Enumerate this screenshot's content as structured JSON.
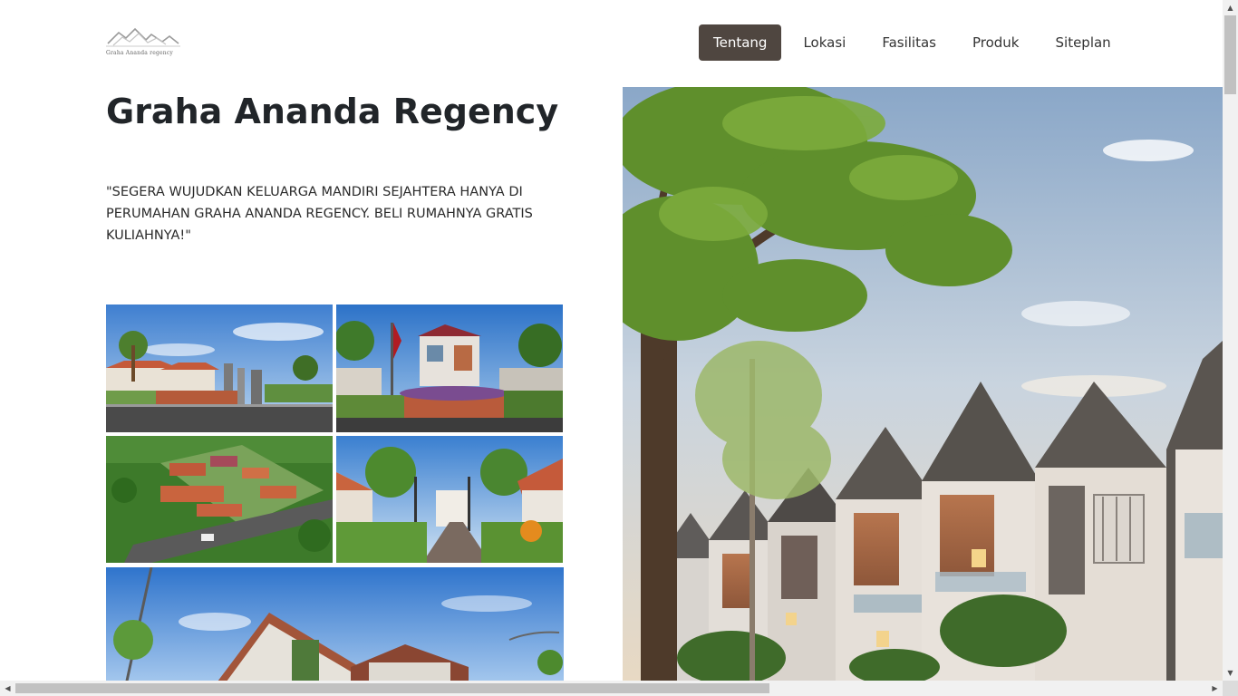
{
  "logo": {
    "text": "Graha Ananda regency"
  },
  "nav": {
    "items": [
      {
        "label": "Tentang",
        "active": true
      },
      {
        "label": "Lokasi",
        "active": false
      },
      {
        "label": "Fasilitas",
        "active": false
      },
      {
        "label": "Produk",
        "active": false
      },
      {
        "label": "Siteplan",
        "active": false
      }
    ]
  },
  "main": {
    "title": "Graha Ananda Regency",
    "tagline": "\"SEGERA WUJUDKAN KELUARGA MANDIRI SEJAHTERA HANYA DI PERUMAHAN GRAHA ANANDA REGENCY. BELI RUMAHNYA GRATIS KULIAHNYA!\""
  },
  "colors": {
    "nav_active_bg": "#4f4640",
    "title": "#212529",
    "scroll_thumb": "#c1c1c1"
  },
  "icons": {
    "scroll_up": "▲",
    "scroll_down": "▼",
    "scroll_left": "◀",
    "scroll_right": "▶"
  }
}
